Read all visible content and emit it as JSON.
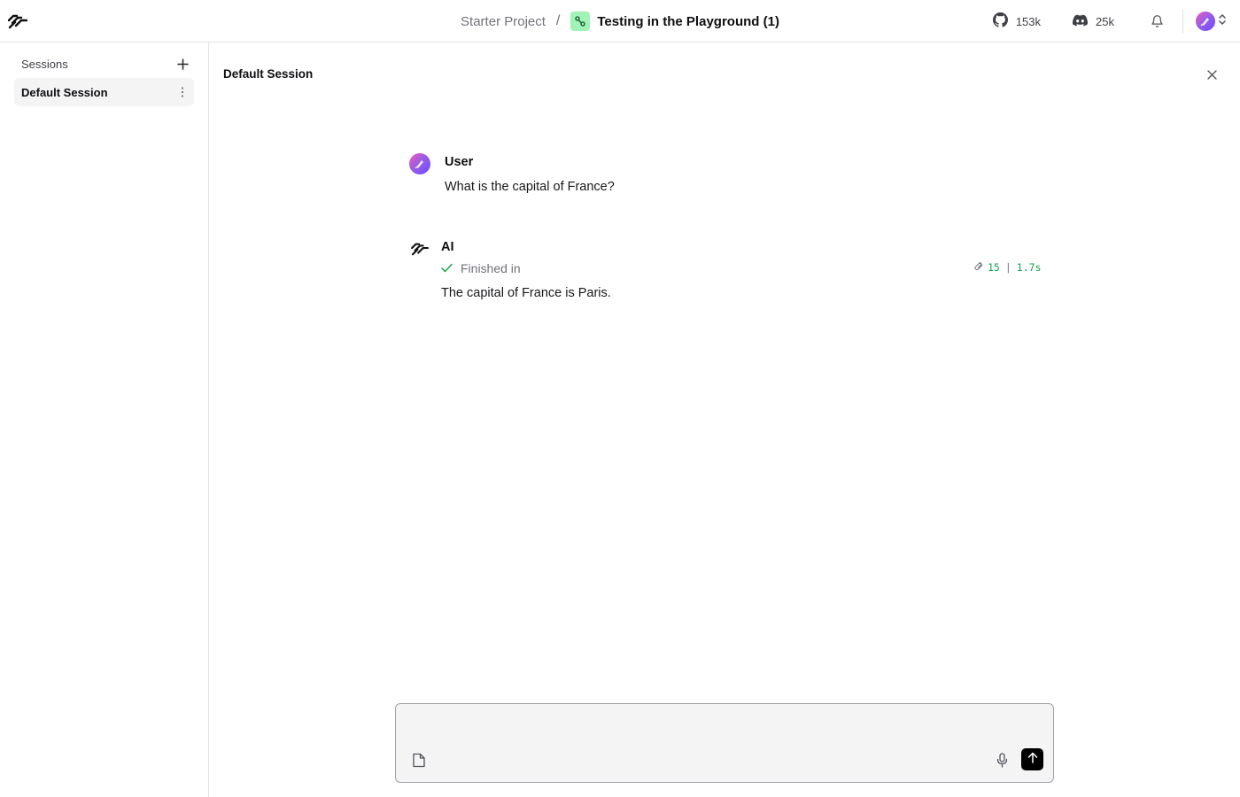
{
  "header": {
    "logo_icon": "langflow-logo-icon",
    "project_name": "Starter Project",
    "separator": "/",
    "flow_icon": "flow-icon",
    "flow_name": "Testing in the Playground (1)",
    "github_icon": "github-icon",
    "github_stars": "153k",
    "discord_icon": "discord-icon",
    "discord_members": "25k",
    "notifications_icon": "bell-icon",
    "user_avatar_icon": "avatar-icon",
    "menu_icon": "chevron-up-down-icon"
  },
  "sidebar": {
    "title": "Sessions",
    "add_icon": "plus-icon",
    "sessions": [
      {
        "label": "Default Session",
        "more_icon": "more-vertical-icon"
      }
    ]
  },
  "main": {
    "title": "Default Session",
    "close_icon": "close-icon",
    "messages": [
      {
        "sender": "User",
        "text": "What is the capital of France?"
      },
      {
        "sender": "AI",
        "status": "Finished in",
        "tokens": "15",
        "duration": "1.7s",
        "text": "The capital of France is Paris."
      }
    ]
  },
  "composer": {
    "value": "",
    "placeholder": "",
    "attach_icon": "file-icon",
    "mic_icon": "microphone-icon",
    "send_icon": "arrow-up-icon"
  },
  "colors": {
    "flow_badge": "#9ff3b4",
    "meta_green": "#16a34a",
    "send_button": "#000000",
    "selected_session_bg": "#f4f4f5"
  }
}
